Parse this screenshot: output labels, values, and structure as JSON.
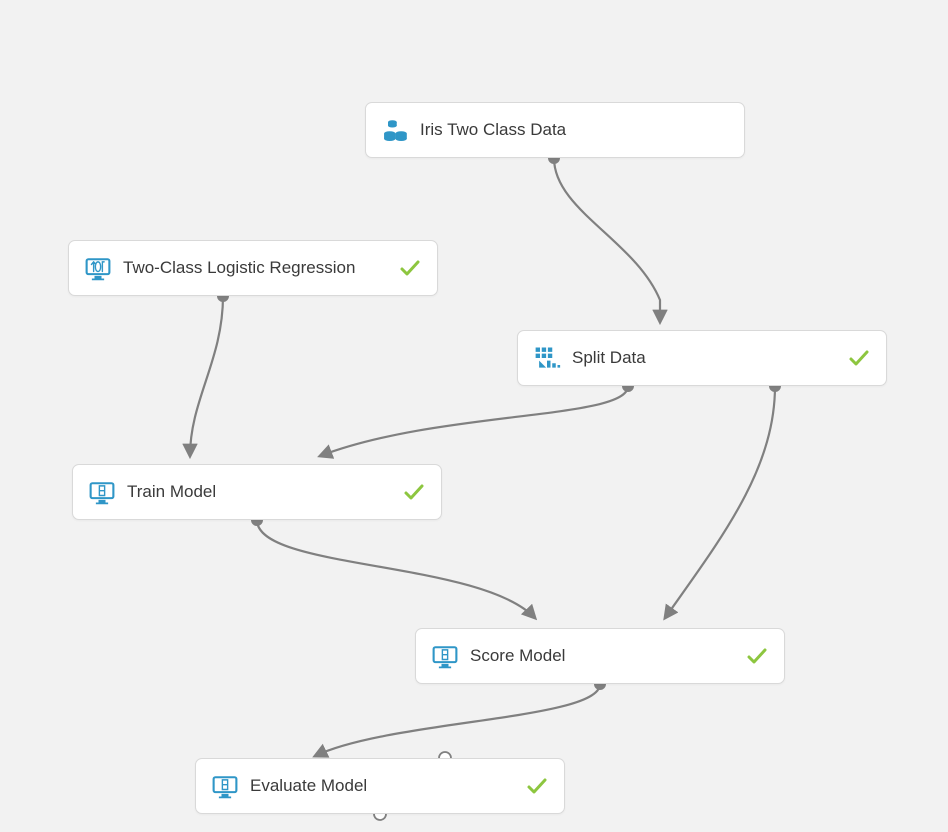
{
  "nodes": {
    "dataset": {
      "label": "Iris Two Class Data",
      "icon": "dataset-icon",
      "status": "ok"
    },
    "algorithm": {
      "label": "Two-Class Logistic Regression",
      "icon": "ml-module-icon",
      "status": "ok"
    },
    "split": {
      "label": "Split Data",
      "icon": "split-icon",
      "status": "ok"
    },
    "train": {
      "label": "Train Model",
      "icon": "ml-module-icon",
      "status": "ok"
    },
    "score": {
      "label": "Score Model",
      "icon": "ml-module-icon",
      "status": "ok"
    },
    "evaluate": {
      "label": "Evaluate Model",
      "icon": "ml-module-icon",
      "status": "ok"
    }
  },
  "colors": {
    "node_bg": "#ffffff",
    "node_border": "#d9d9d9",
    "icon": "#2f96c7",
    "check": "#8dc63f",
    "edge": "#808080",
    "canvas_bg": "#f2f2f2"
  },
  "edges": [
    {
      "from": "dataset.out0",
      "to": "split.in0"
    },
    {
      "from": "algorithm.out0",
      "to": "train.in0"
    },
    {
      "from": "split.out0",
      "to": "train.in1"
    },
    {
      "from": "split.out1",
      "to": "score.in1"
    },
    {
      "from": "train.out0",
      "to": "score.in0"
    },
    {
      "from": "score.out0",
      "to": "evaluate.in0"
    }
  ]
}
